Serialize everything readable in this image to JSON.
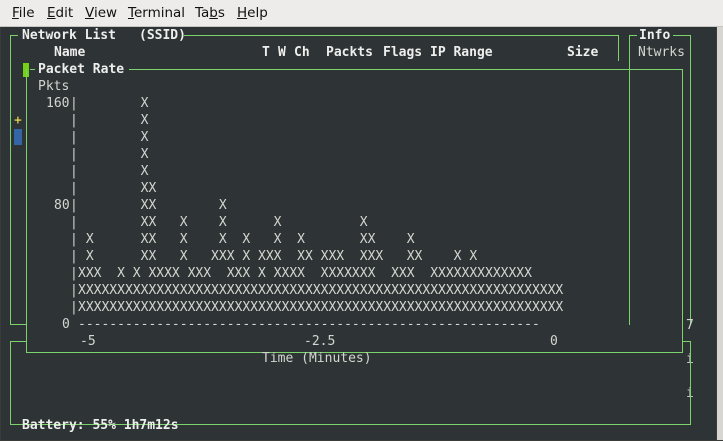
{
  "menu": [
    "File",
    "Edit",
    "View",
    "Terminal",
    "Tabs",
    "Help"
  ],
  "menu_mnemonic": [
    "F",
    "E",
    "V",
    "T",
    "b",
    "H"
  ],
  "network_list": {
    "title": "Network List",
    "sort": "(SSID)",
    "columns": [
      "Name",
      "T",
      "W",
      "Ch",
      "Packts",
      "Flags",
      "IP Range",
      "Size"
    ]
  },
  "info": {
    "title": "Info",
    "ntwrks": "Ntwrks",
    "values": [
      "7",
      "i",
      "i"
    ]
  },
  "packet_rate": {
    "title": "Packet Rate",
    "unit": "Pkts",
    "y_labels": [
      "160",
      "80",
      "0"
    ],
    "x_labels": [
      "-5",
      "-2.5",
      "0"
    ],
    "xlabel": "Time (Minutes)"
  },
  "side_marker": "+",
  "status": "Battery: 55% 1h7m12s",
  "chart_data": {
    "type": "bar",
    "title": "Packet Rate",
    "ylabel": "Pkts",
    "xlabel": "Time (Minutes)",
    "ylim": [
      0,
      160
    ],
    "x_ticks": [
      "-5",
      "-2.5",
      "0"
    ],
    "rows": [
      "        X                                  ",
      "        X                                  ",
      "        X                                  ",
      "        X                                  ",
      "        X                                  ",
      "        XX                                 ",
      "        XX        X                        ",
      "        XX   X    X      X          X      ",
      " X      XX   X    X  X   X  X       XX    X",
      " X      XX   X   XXX X XXX  XX XXX  XXX   XX    X X",
      "XXX  X X XXXX XXX  XXX X XXXX  XXXXXXX  XXX  XXXXXXXXXXXXX",
      "XXXXXXXXXXXXXXXXXXXXXXXXXXXXXXXXXXXXXXXXXXXXXXXXXXXXXXXXXXXXXX",
      "XXXXXXXXXXXXXXXXXXXXXXXXXXXXXXXXXXXXXXXXXXXXXXXXXXXXXXXXXXXXXX"
    ]
  }
}
